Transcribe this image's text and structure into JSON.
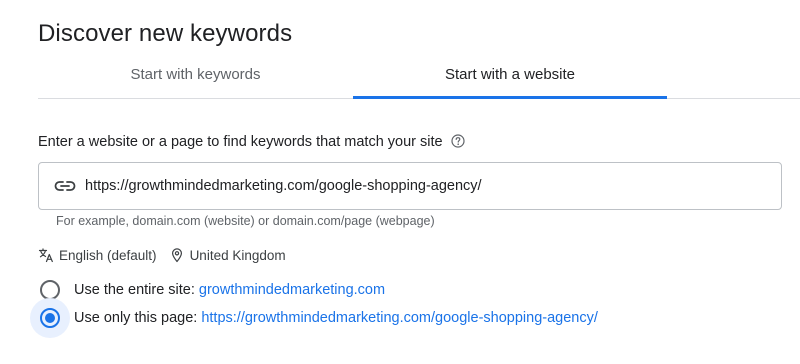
{
  "header": {
    "title": "Discover new keywords"
  },
  "tabs": [
    {
      "label": "Start with keywords",
      "active": false
    },
    {
      "label": "Start with a website",
      "active": true
    }
  ],
  "form": {
    "instruction": "Enter a website or a page to find keywords that match your site",
    "help_icon": "help-circle-icon",
    "url_input": {
      "icon": "link-icon",
      "value": "https://growthmindedmarketing.com/google-shopping-agency/"
    },
    "hint": "For example, domain.com (website) or domain.com/page (webpage)"
  },
  "meta": {
    "language": {
      "icon": "translate-icon",
      "label": "English (default)"
    },
    "location": {
      "icon": "location-pin-icon",
      "label": "United Kingdom"
    }
  },
  "scope_options": [
    {
      "label": "Use the entire site:",
      "link": "growthmindedmarketing.com",
      "selected": false
    },
    {
      "label": "Use only this page:",
      "link": "https://growthmindedmarketing.com/google-shopping-agency/",
      "selected": true
    }
  ],
  "colors": {
    "accent": "#1a73e8",
    "text_primary": "#202124",
    "text_secondary": "#5f6368",
    "divider": "#dadce0"
  }
}
